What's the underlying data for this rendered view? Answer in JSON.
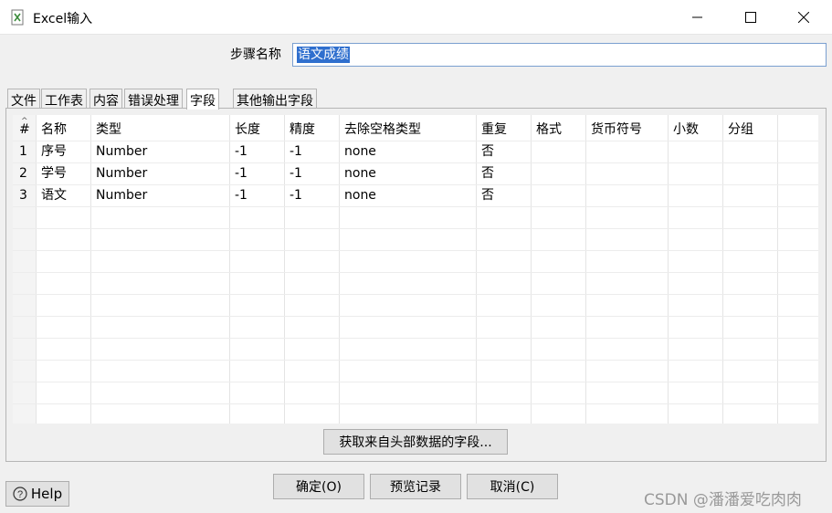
{
  "window": {
    "title": "Excel输入",
    "minimize": "—",
    "maximize": "☐",
    "close": "✕"
  },
  "step": {
    "label": "步骤名称",
    "value": "语文成绩"
  },
  "tabs": [
    {
      "label": "文件"
    },
    {
      "label": "工作表"
    },
    {
      "label": "内容"
    },
    {
      "label": "错误处理"
    },
    {
      "label": "字段",
      "active": true
    },
    {
      "label": "其他输出字段"
    }
  ],
  "table": {
    "columns": [
      "#",
      "名称",
      "类型",
      "长度",
      "精度",
      "去除空格类型",
      "重复",
      "格式",
      "货币符号",
      "小数",
      "分组"
    ],
    "rows": [
      [
        "1",
        "序号",
        "Number",
        "-1",
        "-1",
        "none",
        "否",
        "",
        "",
        "",
        ""
      ],
      [
        "2",
        "学号",
        "Number",
        "-1",
        "-1",
        "none",
        "否",
        "",
        "",
        "",
        ""
      ],
      [
        "3",
        "语文",
        "Number",
        "-1",
        "-1",
        "none",
        "否",
        "",
        "",
        "",
        ""
      ]
    ]
  },
  "buttons": {
    "get_fields": "获取来自头部数据的字段...",
    "ok": "确定(O)",
    "preview": "预览记录",
    "cancel": "取消(C)",
    "help": "Help"
  },
  "watermark": "CSDN @潘潘爱吃肉肉"
}
